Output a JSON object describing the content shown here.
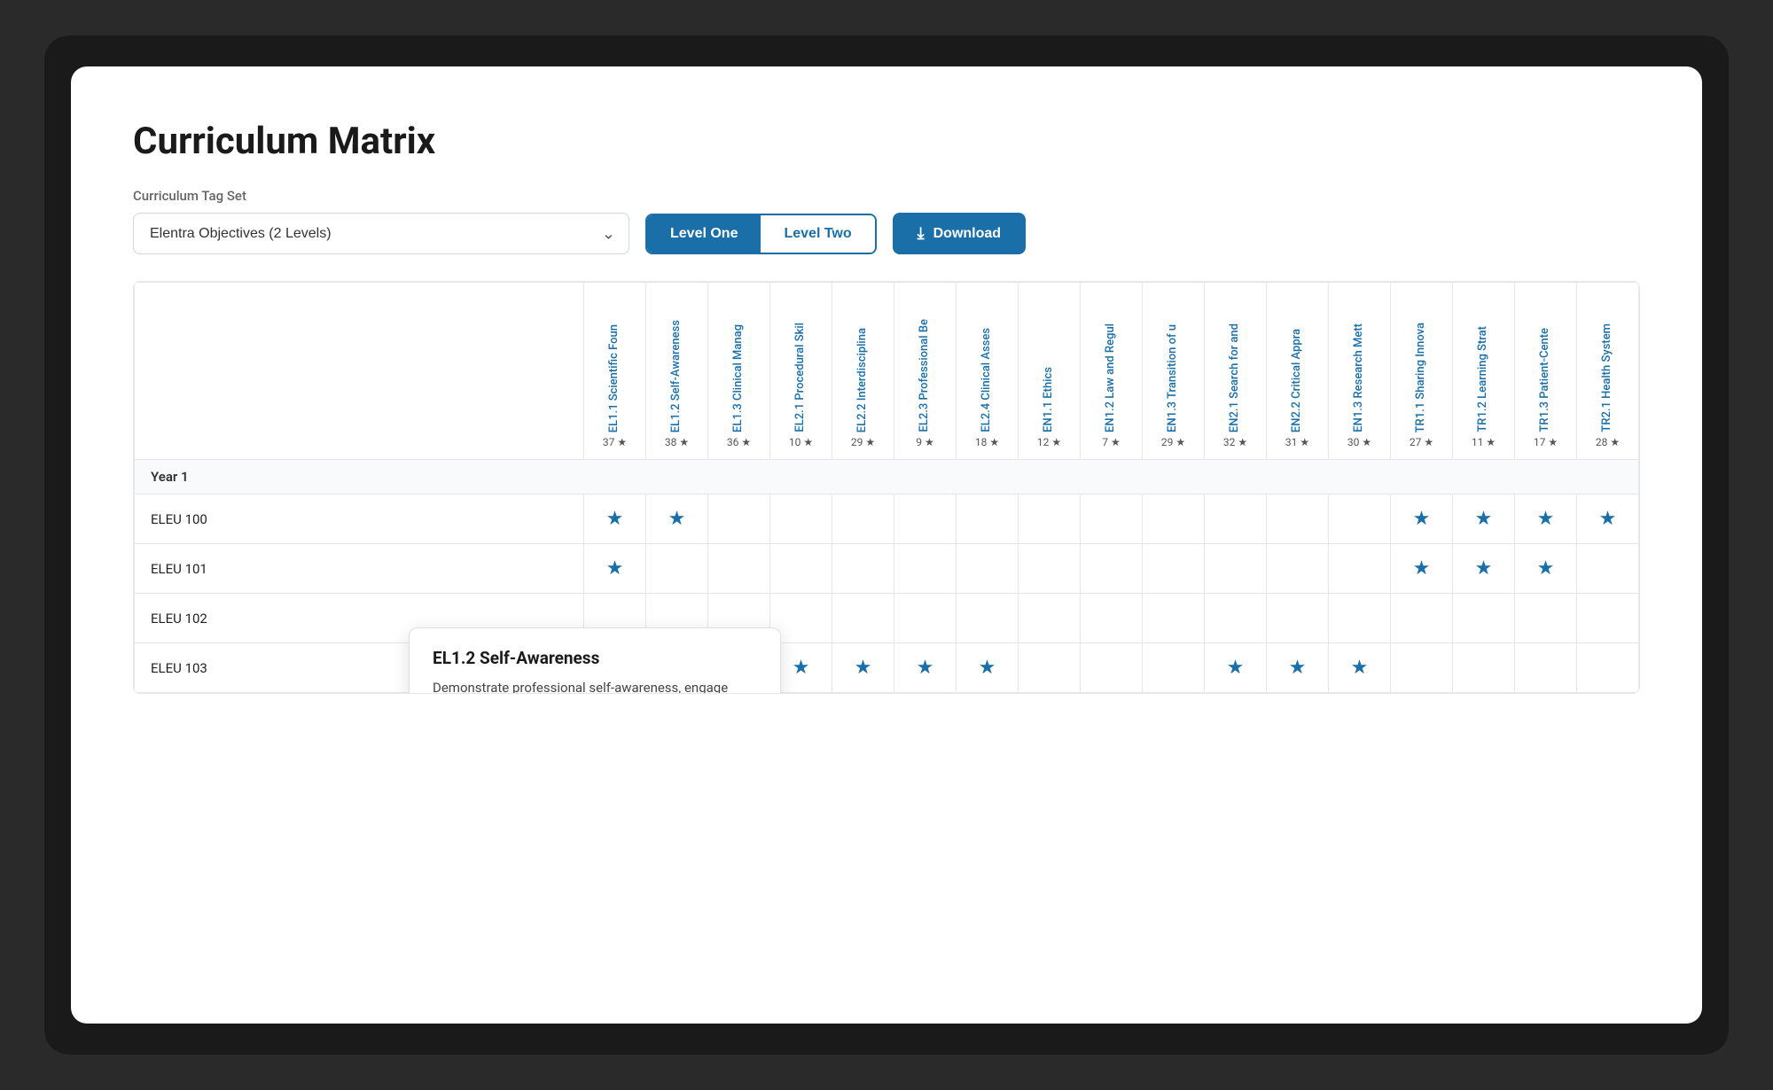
{
  "page": {
    "title": "Curriculum Matrix",
    "tagSetLabel": "Curriculum Tag Set",
    "selectValue": "Elentra Objectives (2 Levels)",
    "selectPlaceholder": "Elentra Objectives (2 Levels)",
    "levelOneLabel": "Level One",
    "levelTwoLabel": "Level Two",
    "downloadLabel": "Download"
  },
  "columns": [
    {
      "id": "col1",
      "label": "EL1.1 Scientific Foun",
      "number": "37 ★"
    },
    {
      "id": "col2",
      "label": "EL1.2 Self-Awareness",
      "number": "38 ★"
    },
    {
      "id": "col3",
      "label": "EL1.3 Clinical Manag",
      "number": "36 ★"
    },
    {
      "id": "col4",
      "label": "EL2.1 Procedural Skil",
      "number": "10 ★"
    },
    {
      "id": "col5",
      "label": "EL2.2 Interdisciplina",
      "number": "29 ★"
    },
    {
      "id": "col6",
      "label": "EL2.3 Professional Be",
      "number": "9 ★"
    },
    {
      "id": "col7",
      "label": "EL2.4 Clinical Asses",
      "number": "18 ★"
    },
    {
      "id": "col8",
      "label": "EN1.1 Ethics",
      "number": "12 ★"
    },
    {
      "id": "col9",
      "label": "EN1.2 Law and Regul",
      "number": "7 ★"
    },
    {
      "id": "col10",
      "label": "EN1.3 Transition of u",
      "number": "29 ★"
    },
    {
      "id": "col11",
      "label": "EN2.1 Search for and",
      "number": "32 ★"
    },
    {
      "id": "col12",
      "label": "EN2.2 Critical Appra",
      "number": "31 ★"
    },
    {
      "id": "col13",
      "label": "EN1.3 Research Mett",
      "number": "30 ★"
    },
    {
      "id": "col14",
      "label": "TR1.1 Sharing Innova",
      "number": "27 ★"
    },
    {
      "id": "col15",
      "label": "TR1.2 Learning Strat",
      "number": "11 ★"
    },
    {
      "id": "col16",
      "label": "TR1.3 Patient-Cente",
      "number": "17 ★"
    },
    {
      "id": "col17",
      "label": "TR2.1 Health System",
      "number": "28 ★"
    }
  ],
  "rows": [
    {
      "type": "year",
      "label": "Year 1",
      "cells": []
    },
    {
      "type": "course",
      "label": "ELEU 100",
      "cells": [
        true,
        true,
        false,
        false,
        false,
        false,
        false,
        false,
        false,
        false,
        false,
        false,
        false,
        true,
        true,
        true,
        true
      ]
    },
    {
      "type": "course",
      "label": "ELEU 101",
      "cells": [
        true,
        false,
        false,
        false,
        false,
        false,
        false,
        false,
        false,
        false,
        false,
        false,
        false,
        true,
        true,
        true,
        false
      ]
    },
    {
      "type": "course",
      "label": "ELEU 102",
      "cells": [
        false,
        false,
        false,
        false,
        false,
        false,
        false,
        false,
        false,
        false,
        false,
        false,
        false,
        false,
        false,
        false,
        false
      ]
    },
    {
      "type": "course",
      "label": "ELEU 103",
      "cells": [
        false,
        true,
        false,
        true,
        true,
        true,
        true,
        false,
        false,
        false,
        true,
        true,
        true,
        false,
        false,
        false,
        false
      ]
    }
  ],
  "tooltip": {
    "title": "EL1.2 Self-Awareness",
    "description": "Demonstrate professional self-awareness, engage consultancy appropriately and maintain competence"
  },
  "colors": {
    "primary": "#1a6fa8",
    "star": "#1a6fa8"
  }
}
